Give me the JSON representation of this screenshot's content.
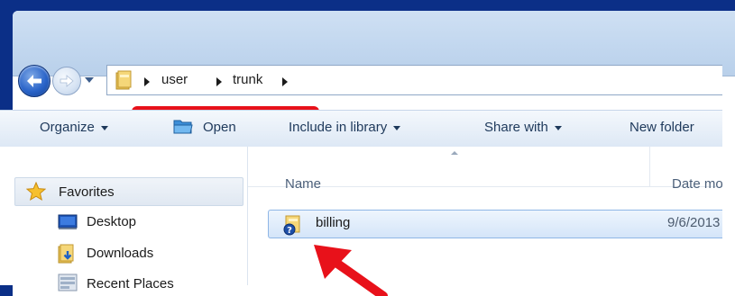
{
  "address_bar": {
    "crumbs": [
      "user",
      "trunk"
    ]
  },
  "toolbar": {
    "organize": "Organize",
    "open": "Open",
    "include_in_library": "Include in library",
    "share_with": "Share with",
    "new_folder": "New folder"
  },
  "nav_pane": {
    "favorites": "Favorites",
    "items": [
      "Desktop",
      "Downloads",
      "Recent Places"
    ]
  },
  "columns": {
    "name": "Name",
    "date_modified": "Date mo"
  },
  "files": [
    {
      "name": "billing",
      "date": "9/6/2013"
    }
  ],
  "colors": {
    "annotation_red": "#e8111a",
    "selection_border": "#8fb6e6",
    "desktop_blue": "#0b2f87"
  }
}
